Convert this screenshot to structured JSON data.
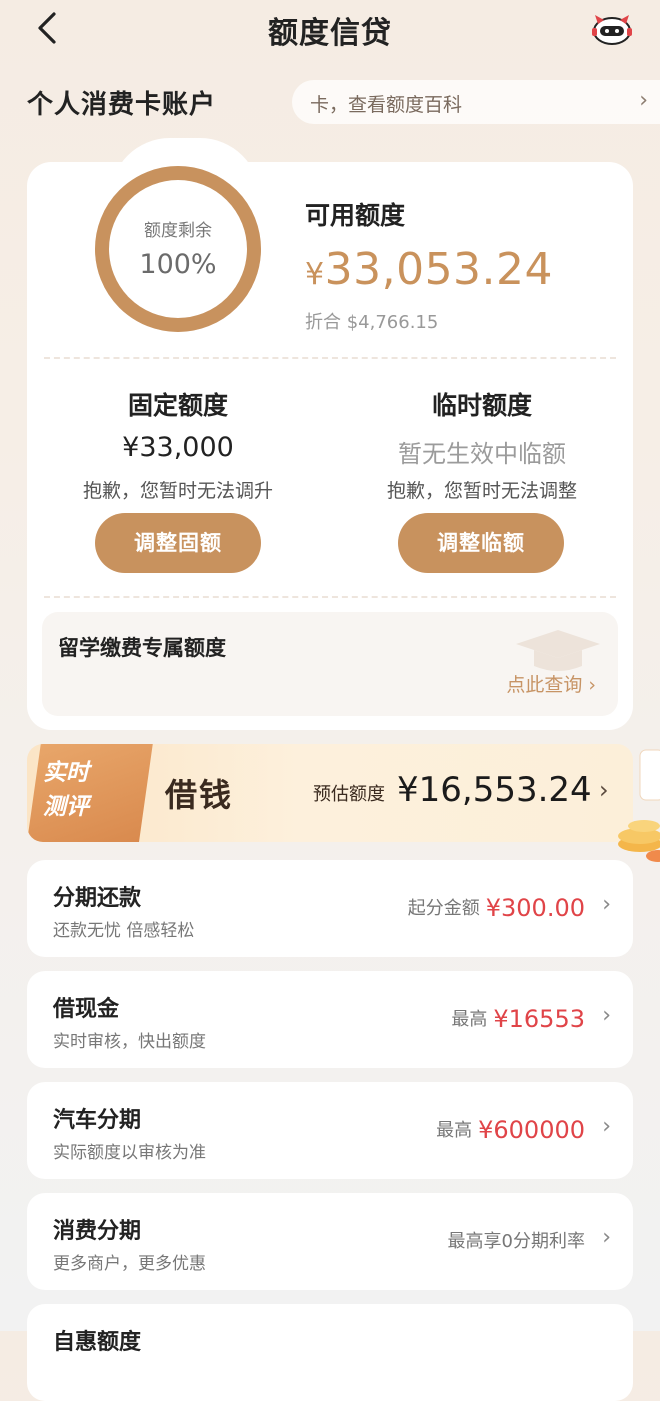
{
  "header": {
    "title": "额度信贷",
    "back_icon": "chevron-left-icon",
    "assistant_icon": "robot-assistant-icon"
  },
  "account": {
    "title": "个人消费卡账户",
    "marquee": "卡，查看额度百科",
    "marquee_chevron": "›"
  },
  "credit": {
    "ring_label": "额度剩余",
    "ring_percent_text": "100%",
    "ring_percent": 100,
    "available_label": "可用额度",
    "currency": "¥",
    "available_amount": "33,053.24",
    "converted": "折合 $4,766.15",
    "fixed": {
      "title": "固定额度",
      "value": "¥33,000",
      "note": "抱歉，您暂时无法调升",
      "button": "调整固额"
    },
    "temporary": {
      "title": "临时额度",
      "value": "暂无生效中临额",
      "note": "抱歉，您暂时无法调整",
      "button": "调整临额"
    },
    "study": {
      "title": "留学缴费专属额度",
      "link": "点此查询 ›"
    }
  },
  "loan_banner": {
    "tag_line1": "实时",
    "tag_line2": "测评",
    "title": "借钱",
    "estimate_label": "预估额度",
    "estimate_amount": "¥16,553.24",
    "chevron": "›"
  },
  "list": [
    {
      "title": "分期还款",
      "subtitle": "还款无忧 倍感轻松",
      "label": "起分金额",
      "amount": "¥300.00"
    },
    {
      "title": "借现金",
      "subtitle": "实时审核，快出额度",
      "label": "最高",
      "amount": "¥16553"
    },
    {
      "title": "汽车分期",
      "subtitle": "实际额度以审核为准",
      "label": "最高",
      "amount": "¥600000"
    },
    {
      "title": "消费分期",
      "subtitle": "更多商户，更多优惠",
      "label": "最高享0分期利率",
      "amount": ""
    },
    {
      "title": "自惠额度",
      "subtitle": "",
      "label": "",
      "amount": ""
    }
  ],
  "colors": {
    "accent": "#c8925e",
    "amount_red": "#e04448",
    "page_bg": "#f5ece3"
  }
}
